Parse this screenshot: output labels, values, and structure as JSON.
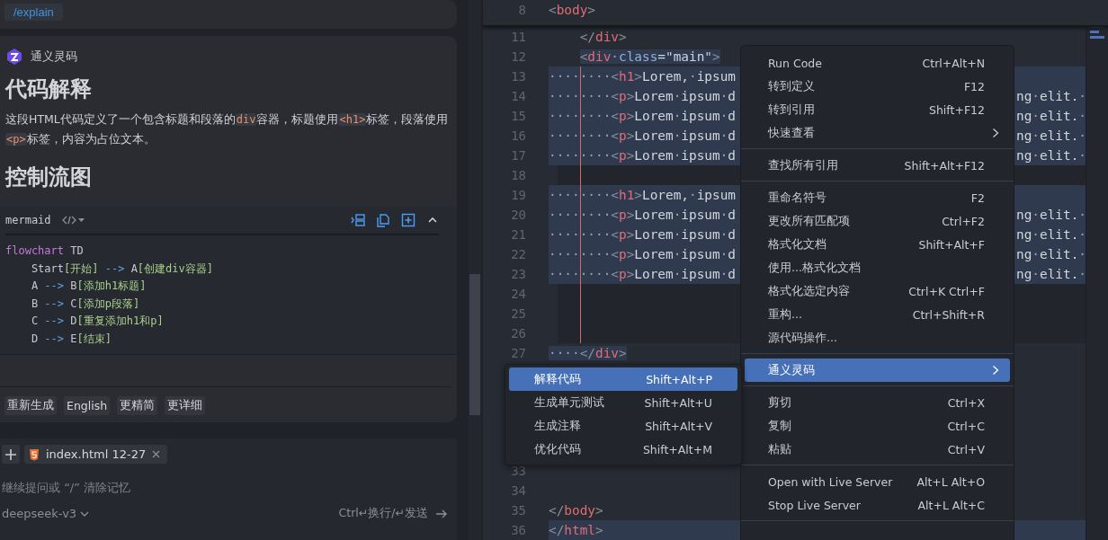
{
  "chat": {
    "command": "/explain",
    "answer": {
      "author": "通义灵码",
      "heading_1": "代码解释",
      "paragraph": [
        {
          "text": "这段HTML代码定义了一个包含标题和段落的"
        },
        {
          "code": "div"
        },
        {
          "text": "容器，标题使用"
        },
        {
          "code": "<h1>"
        },
        {
          "text": "标签，段落使用"
        },
        {
          "code": "<p>"
        },
        {
          "text": "标签，内容为占位文本。"
        }
      ],
      "heading_2": "控制流图",
      "code_block": {
        "language": "mermaid",
        "expanded": true,
        "lines": [
          "flowchart TD",
          "    Start[开始] --> A[创建div容器]",
          "    A --> B[添加h1标题]",
          "    B --> C[添加p段落]",
          "    C --> D[重复添加h1和p]",
          "    D --> E[结束]"
        ]
      },
      "actions": [
        "重新生成",
        "English",
        "更精简",
        "更详细"
      ]
    },
    "input": {
      "context_file": "index.html 12-27",
      "placeholder": "继续提问或 “/” 清除记忆",
      "model": "deepseek-v3",
      "hint": "Ctrl↵换行/↵发送"
    }
  },
  "editor": {
    "sticky_line": {
      "number": "8",
      "text": "<body>"
    },
    "lines_top": [
      {
        "number": "11",
        "text": "    </div>",
        "selected": false
      },
      {
        "number": "12",
        "text": "    <div·class=\"main\">",
        "kind": "partial",
        "selected": true
      },
      {
        "number": "13",
        "text": "········<h1>Lorem,·ipsum",
        "kind": "full",
        "selected": true
      },
      {
        "number": "14",
        "text": "········<p>Lorem·ipsum·d",
        "tail": "ng·elit.·",
        "kind": "full",
        "selected": true
      },
      {
        "number": "15",
        "text": "········<p>Lorem·ipsum·d",
        "tail": "ng·elit.·",
        "kind": "full",
        "selected": true
      },
      {
        "number": "16",
        "text": "········<p>Lorem·ipsum·d",
        "tail": "ng·elit.·",
        "kind": "full",
        "selected": true
      },
      {
        "number": "17",
        "text": "········<p>Lorem·ipsum·d",
        "tail": "ng·elit.·",
        "kind": "full",
        "selected": true
      },
      {
        "number": "18",
        "kind": "blank",
        "selected": true
      },
      {
        "number": "19",
        "text": "········<h1>Lorem,·ipsum",
        "kind": "full",
        "selected": true
      },
      {
        "number": "20",
        "text": "········<p>Lorem·ipsum·d",
        "tail": "ng·elit.·",
        "kind": "full",
        "selected": true
      },
      {
        "number": "21",
        "text": "········<p>Lorem·ipsum·d",
        "tail": "ng·elit.·",
        "kind": "full",
        "selected": true
      },
      {
        "number": "22",
        "text": "········<p>Lorem·ipsum·d",
        "tail": "ng·elit.·",
        "kind": "full",
        "selected": true
      },
      {
        "number": "23",
        "text": "········<p>Lorem·ipsum·d",
        "tail": "ng·elit.·",
        "kind": "full",
        "selected": true
      },
      {
        "number": "24",
        "kind": "blank",
        "selected": true
      },
      {
        "number": "25",
        "kind": "blank",
        "selected": true
      },
      {
        "number": "26",
        "kind": "blank",
        "selected": true
      },
      {
        "number": "27",
        "text": "····</div>",
        "kind": "partial",
        "selected": true
      }
    ],
    "lines_bottom": [
      {
        "number": "33",
        "selected": false
      },
      {
        "number": "34",
        "selected": false
      },
      {
        "number": "35",
        "text": "</body>",
        "selected": false
      },
      {
        "number": "36",
        "text": "</html>",
        "selected": true
      }
    ]
  },
  "context_menu": {
    "groups": [
      [
        {
          "label": "Run Code",
          "shortcut": "Ctrl+Alt+N",
          "submenu": false,
          "selected": false
        },
        {
          "label": "转到定义",
          "shortcut": "F12",
          "submenu": false,
          "selected": false
        },
        {
          "label": "转到引用",
          "shortcut": "Shift+F12",
          "submenu": false,
          "selected": false
        },
        {
          "label": "快速查看",
          "submenu": true,
          "selected": false
        }
      ],
      [
        {
          "label": "查找所有引用",
          "shortcut": "Shift+Alt+F12",
          "submenu": false,
          "selected": false
        }
      ],
      [
        {
          "label": "重命名符号",
          "shortcut": "F2",
          "submenu": false,
          "selected": false
        },
        {
          "label": "更改所有匹配项",
          "shortcut": "Ctrl+F2",
          "submenu": false,
          "selected": false
        },
        {
          "label": "格式化文档",
          "shortcut": "Shift+Alt+F",
          "submenu": false,
          "selected": false
        },
        {
          "label": "使用...格式化文档",
          "submenu": false,
          "selected": false
        },
        {
          "label": "格式化选定内容",
          "shortcut": "Ctrl+K Ctrl+F",
          "submenu": false,
          "selected": false
        },
        {
          "label": "重构...",
          "shortcut": "Ctrl+Shift+R",
          "submenu": false,
          "selected": false
        },
        {
          "label": "源代码操作...",
          "submenu": false,
          "selected": false
        }
      ],
      [
        {
          "label": "通义灵码",
          "submenu": true,
          "selected": true
        }
      ],
      [
        {
          "label": "剪切",
          "shortcut": "Ctrl+X",
          "submenu": false,
          "selected": false
        },
        {
          "label": "复制",
          "shortcut": "Ctrl+C",
          "submenu": false,
          "selected": false
        },
        {
          "label": "粘贴",
          "shortcut": "Ctrl+V",
          "submenu": false,
          "selected": false
        }
      ],
      [
        {
          "label": "Open with Live Server",
          "shortcut": "Alt+L Alt+O",
          "submenu": false,
          "selected": false
        },
        {
          "label": "Stop Live Server",
          "shortcut": "Alt+L Alt+C",
          "submenu": false,
          "selected": false
        }
      ]
    ]
  },
  "submenu": {
    "items": [
      {
        "label": "解释代码",
        "shortcut": "Shift+Alt+P",
        "selected": true
      },
      {
        "label": "生成单元测试",
        "shortcut": "Shift+Alt+U",
        "selected": false
      },
      {
        "label": "生成注释",
        "shortcut": "Shift+Alt+V",
        "selected": false
      },
      {
        "label": "优化代码",
        "shortcut": "Shift+Alt+M",
        "selected": false
      }
    ]
  }
}
